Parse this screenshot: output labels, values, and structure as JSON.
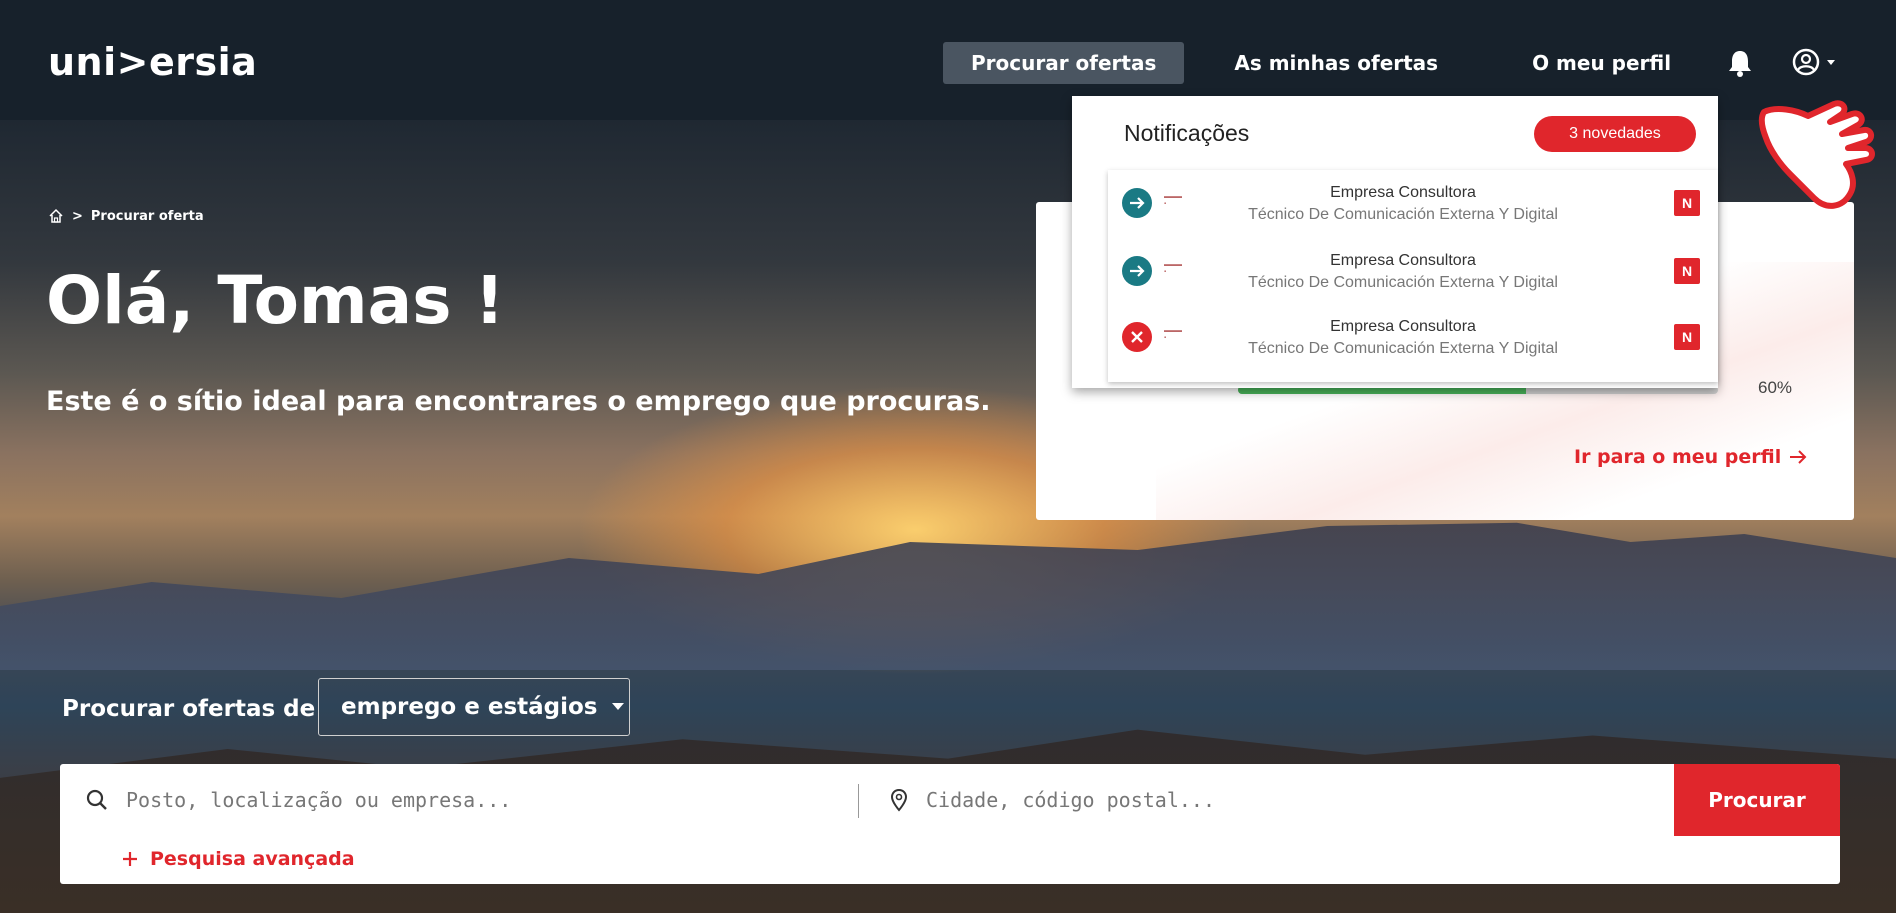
{
  "header": {
    "logo": "uni>ersia",
    "nav": [
      {
        "label": "Procurar ofertas",
        "active": true
      },
      {
        "label": "As minhas ofertas",
        "active": false
      },
      {
        "label": "O meu perfil",
        "active": false
      }
    ],
    "icons": {
      "notifications": "bell-icon",
      "user": "user-circle-icon",
      "user_caret": "caret-down-icon"
    }
  },
  "hero": {
    "breadcrumb": {
      "home_icon": "home-icon",
      "separator": ">",
      "current": "Procurar oferta"
    },
    "greeting": "Olá, Tomas !",
    "subtitle": "Este é o sítio ideal para encontrares o emprego que procuras."
  },
  "profile_card": {
    "progress_percent": 60,
    "progress_label": "60%",
    "link": "Ir para o meu perfil"
  },
  "notifications": {
    "title": "Notificações",
    "badge": "3 novedades",
    "items": [
      {
        "status": "arrow-right",
        "company": "Empresa Consultora",
        "job": "Técnico De Comunicación Externa Y Digital",
        "new": "N"
      },
      {
        "status": "arrow-right",
        "company": "Empresa Consultora",
        "job": "Técnico De Comunicación Externa Y Digital",
        "new": "N"
      },
      {
        "status": "close",
        "company": "Empresa Consultora",
        "job": "Técnico De Comunicación Externa Y Digital",
        "new": "N"
      }
    ]
  },
  "search": {
    "label": "Procurar ofertas de",
    "type_selected": "emprego e estágios",
    "query_placeholder": "Posto, localização ou empresa...",
    "location_placeholder": "Cidade, código postal...",
    "button": "Procurar",
    "advanced": "Pesquisa avançada"
  },
  "colors": {
    "header_bg": "#17212b",
    "accent": "#e0262c",
    "progress": "#49b35a",
    "status_ok": "#1a7a84"
  }
}
